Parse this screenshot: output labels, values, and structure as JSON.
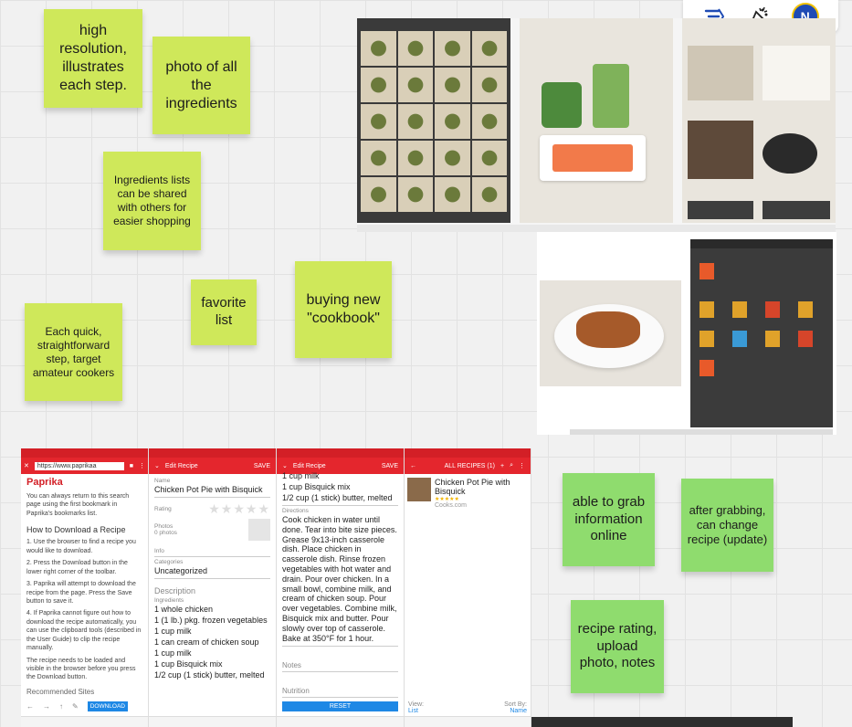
{
  "stickies": {
    "high_res": "high resolution, illustrates each step.",
    "photo_ingredients": "photo of all the ingredients",
    "ingredients_shared": "Ingredients lists can be shared with others for easier shopping",
    "favorite_list": "favorite list",
    "buying_cookbook": "buying new \"cookbook\"",
    "each_step": "Each quick, straightforward step, target amateur cookers",
    "grab_online": "able to grab information online",
    "after_grabbing": "after grabbing, can change recipe (update)",
    "recipe_rating": "recipe rating, upload photo, notes"
  },
  "toolbar": {
    "avatar_initial": "N"
  },
  "colors": {
    "lime": "#cfe85a",
    "green": "#8fdc6e",
    "paprika_red": "#e4262d"
  },
  "phone1": {
    "url": "https://www.paprikaa",
    "brand": "Paprika",
    "note": "You can always return to this search page using the first bookmark in Paprika's bookmarks list.",
    "heading": "How to Download a Recipe",
    "steps": [
      "1. Use the browser to find a recipe you would like to download.",
      "2. Press the Download button in the lower right corner of the toolbar.",
      "3. Paprika will attempt to download the recipe from the page. Press the Save button to save it.",
      "4. If Paprika cannot figure out how to download the recipe automatically, you can use the clipboard tools (described in the User Guide) to clip the recipe manually."
    ],
    "note2": "The recipe needs to be loaded and visible in the browser before you press the Download button.",
    "recommended": "Recommended Sites",
    "download_btn": "DOWNLOAD"
  },
  "phone2": {
    "title": "Edit Recipe",
    "save": "SAVE",
    "name_label": "Name",
    "name_value": "Chicken Pot Pie with Bisquick",
    "rating_label": "Rating",
    "photos_label": "Photos",
    "photos_value": "0 photos",
    "info_label": "Info",
    "categories_label": "Categories",
    "categories_value": "Uncategorized",
    "description_label": "Description",
    "ingredients_label": "Ingredients",
    "ingredients": [
      "1 whole chicken",
      "1 (1 lb.) pkg. frozen vegetables",
      "1 cup milk",
      "1 can cream of chicken soup",
      "1 cup milk",
      "1 cup Bisquick mix",
      "1/2 cup (1 stick) butter, melted"
    ]
  },
  "phone3": {
    "title": "Edit Recipe",
    "save": "SAVE",
    "top_lines": [
      "1 cup milk",
      "1 cup Bisquick mix",
      "1/2 cup (1 stick) butter, melted"
    ],
    "directions_label": "Directions",
    "directions": "Cook chicken in water until done. Tear into bite size pieces. Grease 9x13-inch casserole dish. Place chicken in casserole dish. Rinse frozen vegetables with hot water and drain. Pour over chicken. In a small bowl, combine milk, and cream of chicken soup. Pour over vegetables. Combine milk, Bisquick mix and butter. Pour slowly over top of casserole. Bake at 350°F for 1 hour.",
    "notes_label": "Notes",
    "nutrition_label": "Nutrition",
    "reset": "RESET"
  },
  "phone4": {
    "title": "ALL RECIPES (1)",
    "recipe_name": "Chicken Pot Pie with Bisquick",
    "stars": "★★★★★",
    "source": "Cooks.com",
    "view_label": "View:",
    "view_value": "List",
    "sort_label": "Sort By:",
    "sort_value": "Name"
  }
}
